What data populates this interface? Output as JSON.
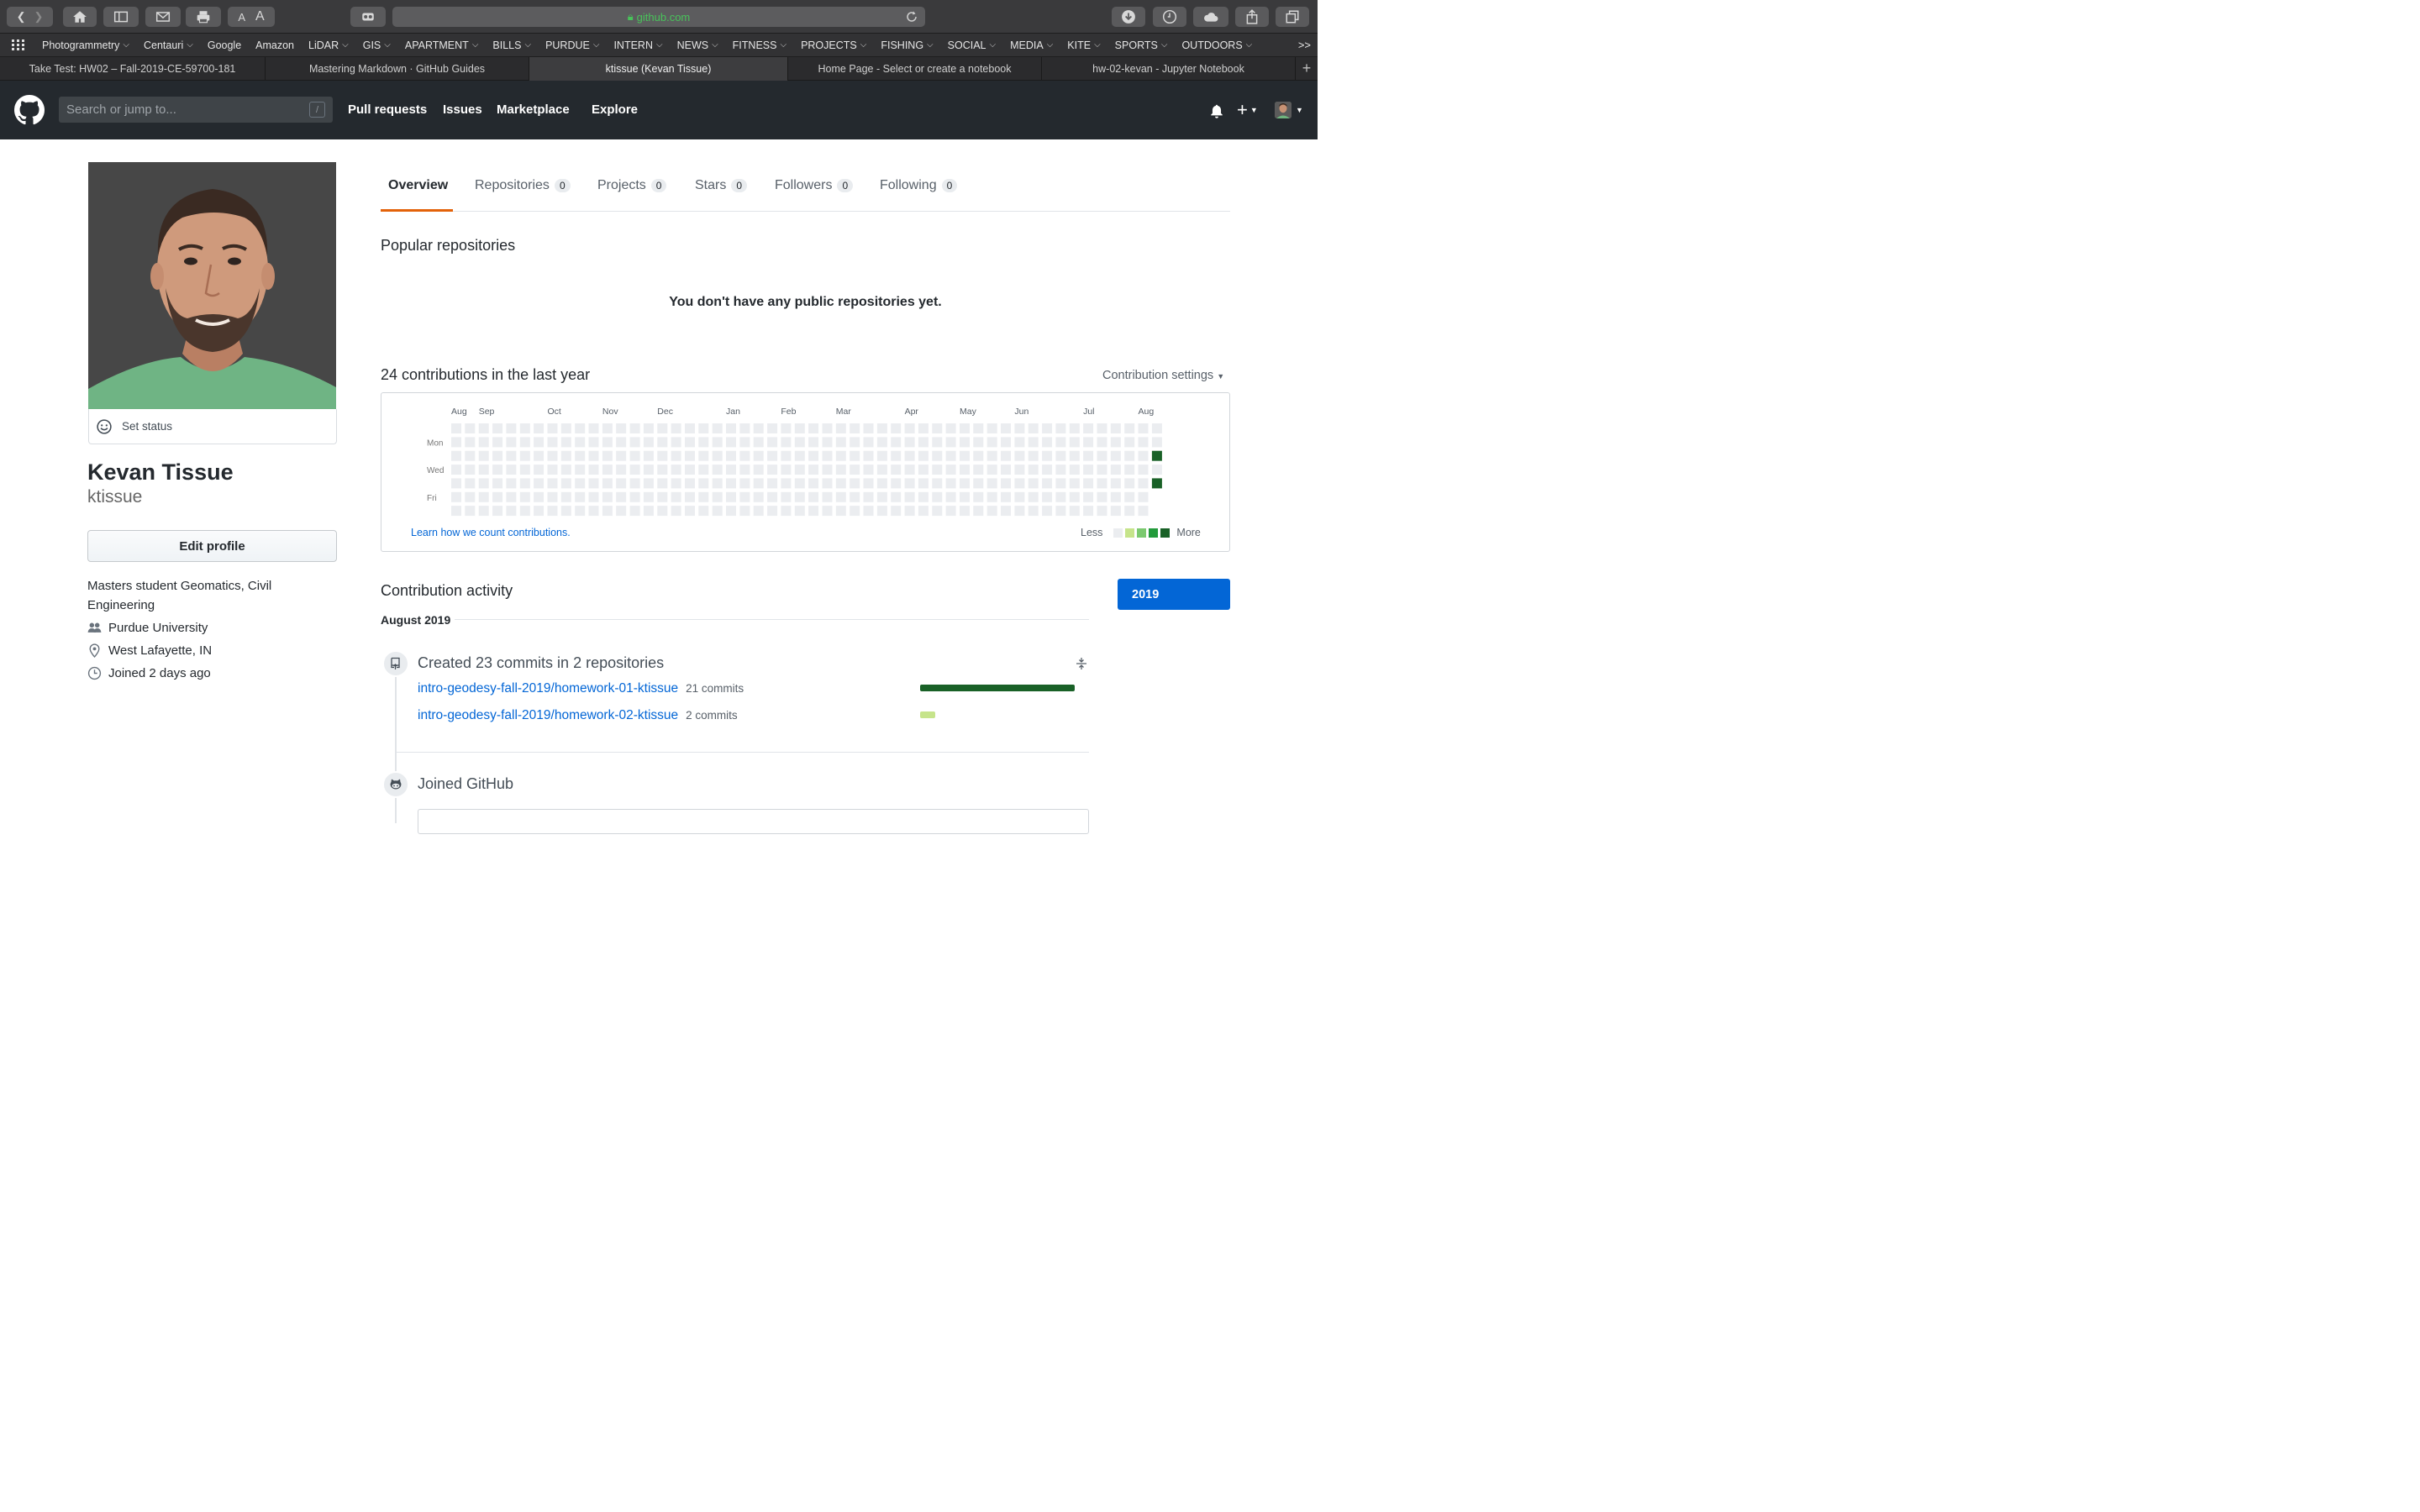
{
  "browser": {
    "url": "github.com",
    "bookmarks": [
      {
        "label": "Photogrammetry",
        "menu": true
      },
      {
        "label": "Centauri",
        "menu": true
      },
      {
        "label": "Google",
        "menu": false
      },
      {
        "label": "Amazon",
        "menu": false
      },
      {
        "label": "LiDAR",
        "menu": true
      },
      {
        "label": "GIS",
        "menu": true
      },
      {
        "label": "APARTMENT",
        "menu": true
      },
      {
        "label": "BILLS",
        "menu": true
      },
      {
        "label": "PURDUE",
        "menu": true
      },
      {
        "label": "INTERN",
        "menu": true
      },
      {
        "label": "NEWS",
        "menu": true
      },
      {
        "label": "FITNESS",
        "menu": true
      },
      {
        "label": "PROJECTS",
        "menu": true
      },
      {
        "label": "FISHING",
        "menu": true
      },
      {
        "label": "SOCIAL",
        "menu": true
      },
      {
        "label": "MEDIA",
        "menu": true
      },
      {
        "label": "KITE",
        "menu": true
      },
      {
        "label": "SPORTS",
        "menu": true
      },
      {
        "label": "OUTDOORS",
        "menu": true
      }
    ],
    "bookmarks_overflow": ">>",
    "tabs": [
      {
        "label": "Take Test: HW02 – Fall-2019-CE-59700-181",
        "active": false
      },
      {
        "label": "Mastering Markdown · GitHub Guides",
        "active": false
      },
      {
        "label": "ktissue (Kevan Tissue)",
        "active": true
      },
      {
        "label": "Home Page - Select or create a notebook",
        "active": false
      },
      {
        "label": "hw-02-kevan - Jupyter Notebook",
        "active": false
      }
    ],
    "new_tab": "+"
  },
  "header": {
    "search_placeholder": "Search or jump to...",
    "search_hint": "/",
    "nav": {
      "pulls": "Pull requests",
      "issues": "Issues",
      "marketplace": "Marketplace",
      "explore": "Explore"
    }
  },
  "profile": {
    "set_status": "Set status",
    "full_name": "Kevan Tissue",
    "username": "ktissue",
    "edit_button": "Edit profile",
    "bio": "Masters student Geomatics, Civil Engineering",
    "organization": "Purdue University",
    "location": "West Lafayette, IN",
    "joined": "Joined 2 days ago"
  },
  "tabs": {
    "overview": "Overview",
    "repositories": {
      "label": "Repositories",
      "count": "0"
    },
    "projects": {
      "label": "Projects",
      "count": "0"
    },
    "stars": {
      "label": "Stars",
      "count": "0"
    },
    "followers": {
      "label": "Followers",
      "count": "0"
    },
    "following": {
      "label": "Following",
      "count": "0"
    }
  },
  "popular": {
    "heading": "Popular repositories",
    "empty_message": "You don't have any public repositories yet."
  },
  "contributions": {
    "heading": "24 contributions in the last year",
    "settings_label": "Contribution settings",
    "months": [
      "Aug",
      "Sep",
      "Oct",
      "Nov",
      "Dec",
      "Jan",
      "Feb",
      "Mar",
      "Apr",
      "May",
      "Jun",
      "Jul",
      "Aug"
    ],
    "month_week_index": [
      0,
      2,
      7,
      11,
      15,
      20,
      24,
      28,
      33,
      37,
      41,
      46,
      50
    ],
    "weekday_labels": {
      "mon": "Mon",
      "wed": "Wed",
      "fri": "Fri"
    },
    "weeks": 52,
    "last_week_days": 5,
    "active_cells": [
      {
        "week": 51,
        "day": 2,
        "level": 4
      },
      {
        "week": 51,
        "day": 4,
        "level": 4
      }
    ],
    "learn_link": "Learn how we count contributions.",
    "legend_less": "Less",
    "legend_more": "More",
    "colors": {
      "empty": "#ebedf0",
      "l1": "#c6e48b",
      "l2": "#7bc96f",
      "l3": "#239a3b",
      "l4": "#196127"
    }
  },
  "activity": {
    "heading": "Contribution activity",
    "year": "2019",
    "month": "August 2019",
    "commits_title": "Created 23 commits in 2 repositories",
    "repos": [
      {
        "name": "intro-geodesy-fall-2019/homework-01-ktissue",
        "count_label": "21 commits",
        "commits": 21,
        "color": "#196127"
      },
      {
        "name": "intro-geodesy-fall-2019/homework-02-ktissue",
        "count_label": "2 commits",
        "commits": 2,
        "color": "#c6e48b"
      }
    ],
    "joined_title": "Joined GitHub"
  }
}
